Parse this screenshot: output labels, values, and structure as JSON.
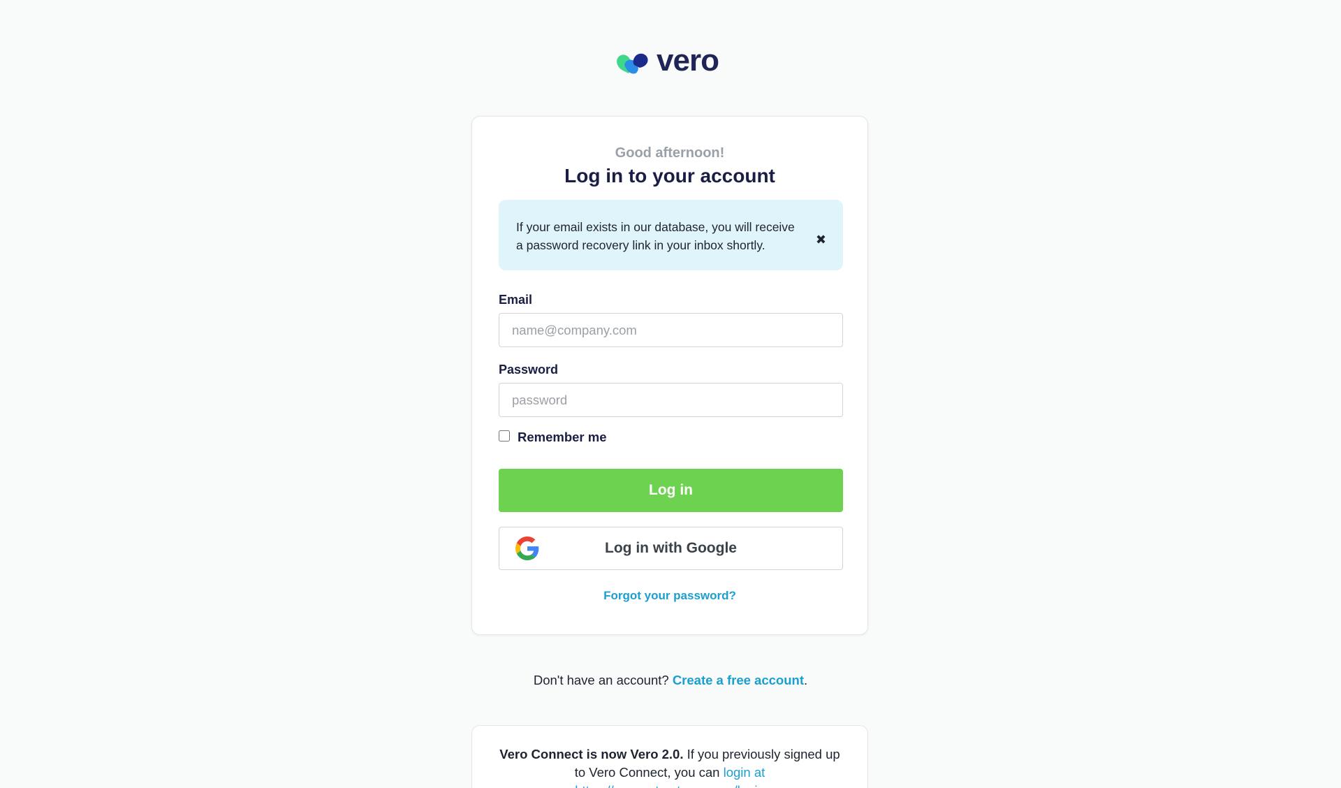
{
  "brand": {
    "name": "vero",
    "colors": {
      "primary_dark": "#1f2557",
      "mark_green": "#3fd88a",
      "mark_blue": "#2a8de6",
      "mark_navy": "#1c2a8c"
    }
  },
  "login_card": {
    "greeting": "Good afternoon!",
    "title": "Log in to your account",
    "alert": {
      "message": "If your email exists in our database, you will receive a password recovery link in your inbox shortly.",
      "close_icon": "✖"
    },
    "email": {
      "label": "Email",
      "placeholder": "name@company.com",
      "value": ""
    },
    "password": {
      "label": "Password",
      "placeholder": "password",
      "value": ""
    },
    "remember_me": {
      "label": "Remember me",
      "checked": false
    },
    "login_button": "Log in",
    "google_button": "Log in with Google",
    "forgot_link": "Forgot your password?"
  },
  "signup": {
    "prompt": "Don't have an account?",
    "link": "Create a free account",
    "suffix": "."
  },
  "notice": {
    "bold": "Vero Connect is now Vero 2.0.",
    "text": "If you previously signed up to Vero Connect, you can",
    "link": "login at https://connect.getvero.com/login"
  },
  "theme": {
    "background": "#f9fafa",
    "accent_link": "#1a9fd0",
    "primary_button": "#6dd250",
    "alert_background": "#e0f4fb"
  }
}
